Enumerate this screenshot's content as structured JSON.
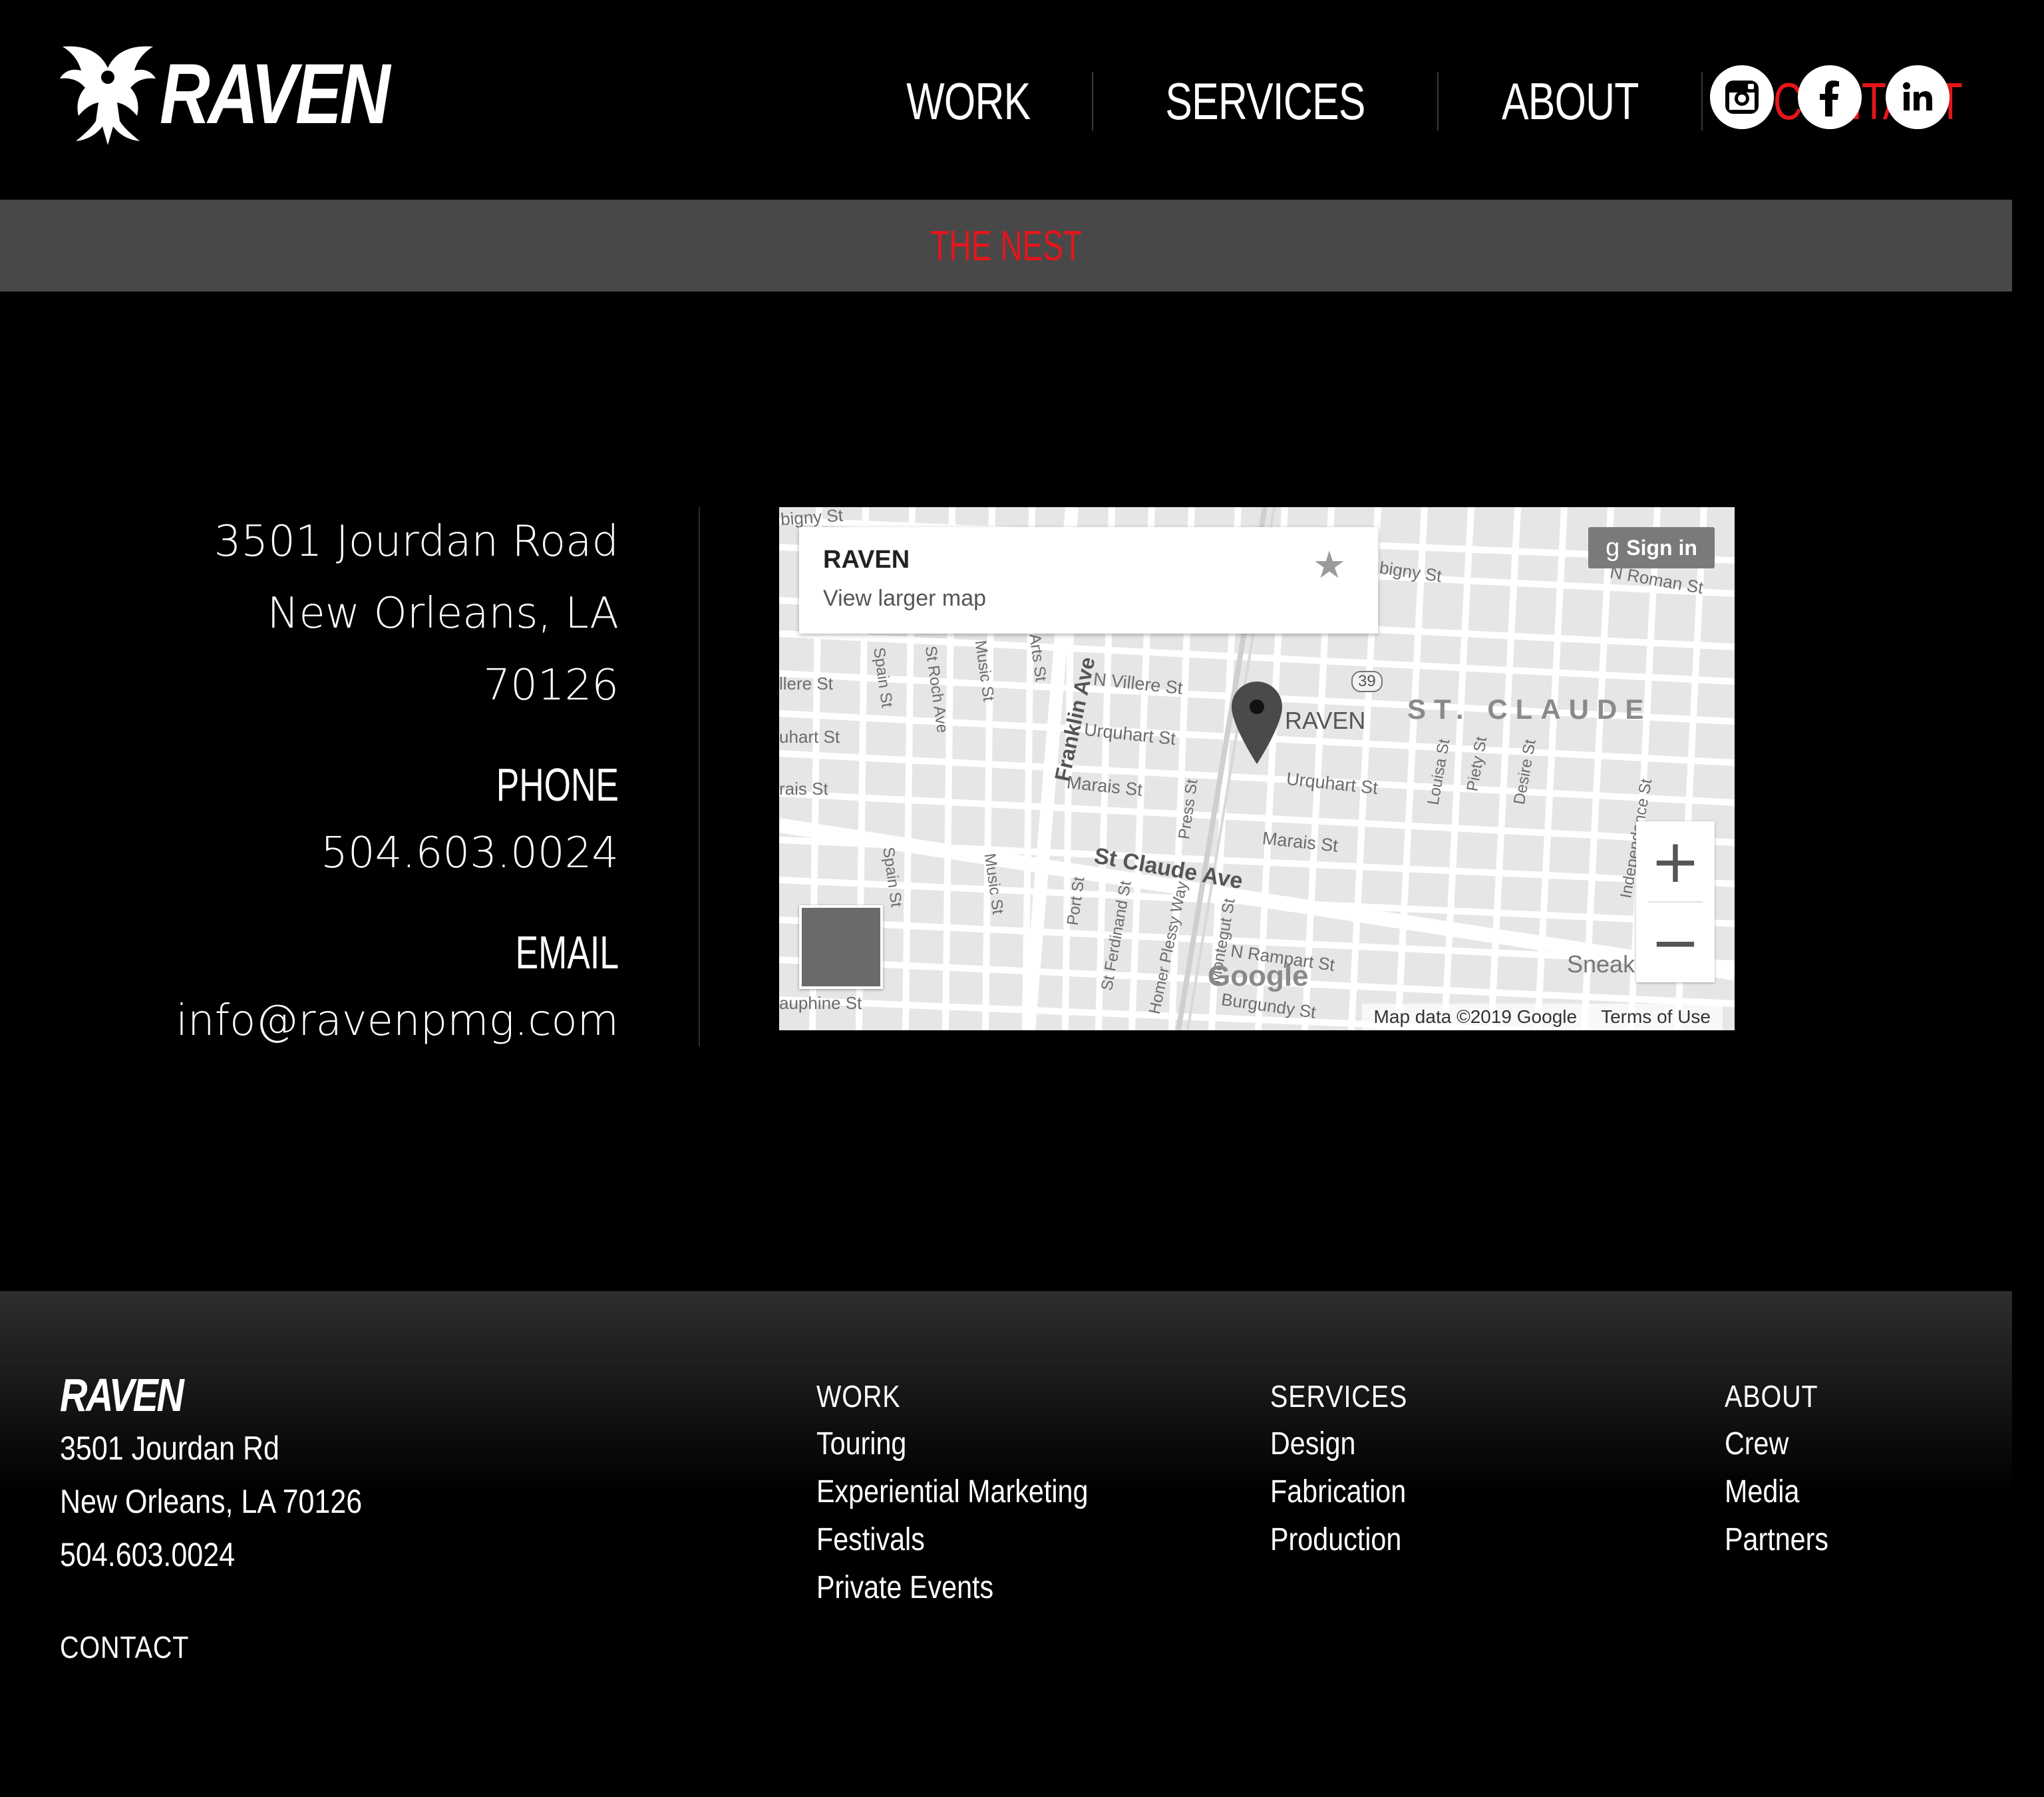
{
  "brand": {
    "name": "RAVEN"
  },
  "nav": {
    "items": [
      {
        "label": "WORK",
        "active": false
      },
      {
        "label": "SERVICES",
        "active": false
      },
      {
        "label": "ABOUT",
        "active": false
      },
      {
        "label": "CONTACT",
        "active": true
      }
    ]
  },
  "social": [
    {
      "icon": "instagram-icon"
    },
    {
      "icon": "facebook-icon"
    },
    {
      "icon": "linkedin-icon"
    }
  ],
  "banner": {
    "title": "THE NEST"
  },
  "contact": {
    "address_line1": "3501 Jourdan Road",
    "address_line2": "New Orleans, LA 70126",
    "phone_label": "PHONE",
    "phone": "504.603.0024",
    "email_label": "EMAIL",
    "email": "info@ravenpmg.com"
  },
  "map": {
    "place_name": "RAVEN",
    "view_larger": "View larger map",
    "sign_in": "Sign in",
    "pin_label": "RAVEN",
    "neighborhood": "ST. CLAUDE",
    "streets": {
      "bigny_top": "bigny St",
      "bigny_right": "bigny St",
      "roman": "N Roman St",
      "n_villere": "N Villere St",
      "urquhart_mid": "Urquhart St",
      "urquhart_right": "Urquhart St",
      "marais_mid": "Marais St",
      "marais_right": "Marais St",
      "st_claude": "St Claude Ave",
      "franklin": "Franklin Ave",
      "spain_top": "Spain St",
      "spain_bottom": "Spain St",
      "st_roch": "St Roch Ave",
      "music_top": "Music St",
      "music_bottom": "Music St",
      "arts": "Arts St",
      "press": "Press St",
      "port": "Port St",
      "st_ferdinand": "St Ferdinand St",
      "homer_plessy": "Homer Plessy Way",
      "montegut": "Montegut St",
      "n_rampart": "N Rampart St",
      "burgundy": "Burgundy St",
      "louisa": "Louisa St",
      "piety": "Piety St",
      "desire": "Desire St",
      "independence": "Independence St",
      "villere_left": "llere St",
      "urquhart_left": "uhart St",
      "marais_left": "rais St",
      "dauphine": "auphine St",
      "sneak": "Sneak",
      "route_39": "39"
    },
    "attribution": "Map data ©2019 Google",
    "terms": "Terms of Use",
    "google": "Google"
  },
  "footer": {
    "logo": "RAVEN",
    "address_line1": "3501 Jourdan Rd",
    "address_line2": "New Orleans, LA 70126",
    "phone": "504.603.0024",
    "contact_link": "CONTACT",
    "columns": [
      {
        "heading": "WORK",
        "links": [
          "Touring",
          "Experiential Marketing",
          "Festivals",
          "Private Events"
        ]
      },
      {
        "heading": "SERVICES",
        "links": [
          "Design",
          "Fabrication",
          "Production"
        ]
      },
      {
        "heading": "ABOUT",
        "links": [
          "Crew",
          "Media",
          "Partners"
        ]
      }
    ]
  },
  "colors": {
    "accent": "#e4161b",
    "banner_bg": "#484848",
    "page_bg": "#000000"
  }
}
